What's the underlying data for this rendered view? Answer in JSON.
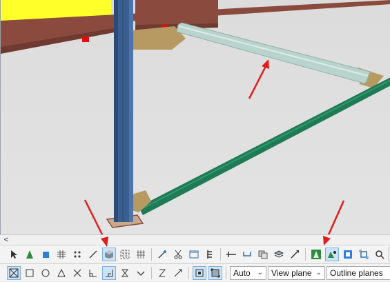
{
  "viewport": {
    "scroll_left_glyph": "<"
  },
  "toolbar_top": {
    "buttons": [
      "select-pointer-icon",
      "green-cone-icon",
      "blue-square-icon",
      "grid-dotted-icon",
      "dots-icon",
      "line-icon",
      "box-3d-icon",
      "grid-select-icon",
      "grid-points-icon",
      "wand-icon",
      "scissors-icon",
      "window-icon",
      "ladder-icon",
      "beam-icon",
      "cup-icon",
      "plates-icon",
      "layers-icon",
      "pencil-arrow-icon",
      "green-tree-icon",
      "green-node-icon",
      "blue-target-icon",
      "select-frame-icon",
      "zoom-icon"
    ],
    "search_stub": "s"
  },
  "toolbar_bottom": {
    "dropdowns": {
      "snap_depth": "Auto",
      "plane": "View plane",
      "outline": "Outline planes"
    }
  },
  "colors": {
    "accent_blue": "#2f7fd6",
    "active_bg": "#cde3f7",
    "arrow_red": "#e21c1c",
    "beam_brown": "#8b4a3e",
    "column_blue": "#3c5f93",
    "brace_green": "#1f7a55",
    "brace_light": "#b9d4cc",
    "highlight_yellow": "#ffff2a",
    "plate_tan": "#b69a62"
  }
}
